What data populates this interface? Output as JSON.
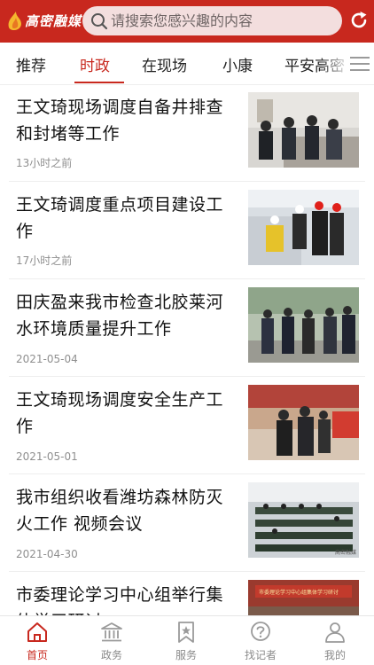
{
  "header": {
    "logo_text": "高密融媒",
    "search_placeholder": "请搜索您感兴趣的内容"
  },
  "tabs": [
    {
      "label": "推荐",
      "active": false
    },
    {
      "label": "时政",
      "active": true
    },
    {
      "label": "在现场",
      "active": false
    },
    {
      "label": "小康",
      "active": false
    },
    {
      "label": "平安高密",
      "active": false
    }
  ],
  "news": [
    {
      "title": "王文琦现场调度自备井排查和封堵等工作",
      "time": "13小时之前"
    },
    {
      "title": "王文琦调度重点项目建设工作",
      "time": "17小时之前"
    },
    {
      "title": "田庆盈来我市检查北胶莱河水环境质量提升工作",
      "time": "2021-05-04"
    },
    {
      "title": "王文琦现场调度安全生产工作",
      "time": "2021-05-01"
    },
    {
      "title": "我市组织收看潍坊森林防灭火工作  视频会议",
      "time": "2021-04-30"
    },
    {
      "title": "市委理论学习中心组举行集体学习研讨",
      "time": ""
    }
  ],
  "thumb_banner_text": "市委理论学习中心组集体学习研讨",
  "thumb_watermark": "高密融媒",
  "bottom_nav": [
    {
      "label": "首页",
      "icon": "home-icon",
      "active": true
    },
    {
      "label": "政务",
      "icon": "government-icon",
      "active": false
    },
    {
      "label": "服务",
      "icon": "bookmark-star-icon",
      "active": false
    },
    {
      "label": "找记者",
      "icon": "question-icon",
      "active": false
    },
    {
      "label": "我的",
      "icon": "user-icon",
      "active": false
    }
  ],
  "colors": {
    "brand_red": "#c8281e",
    "search_bg": "#f3dede",
    "inactive_gray": "#8a8a8a"
  }
}
